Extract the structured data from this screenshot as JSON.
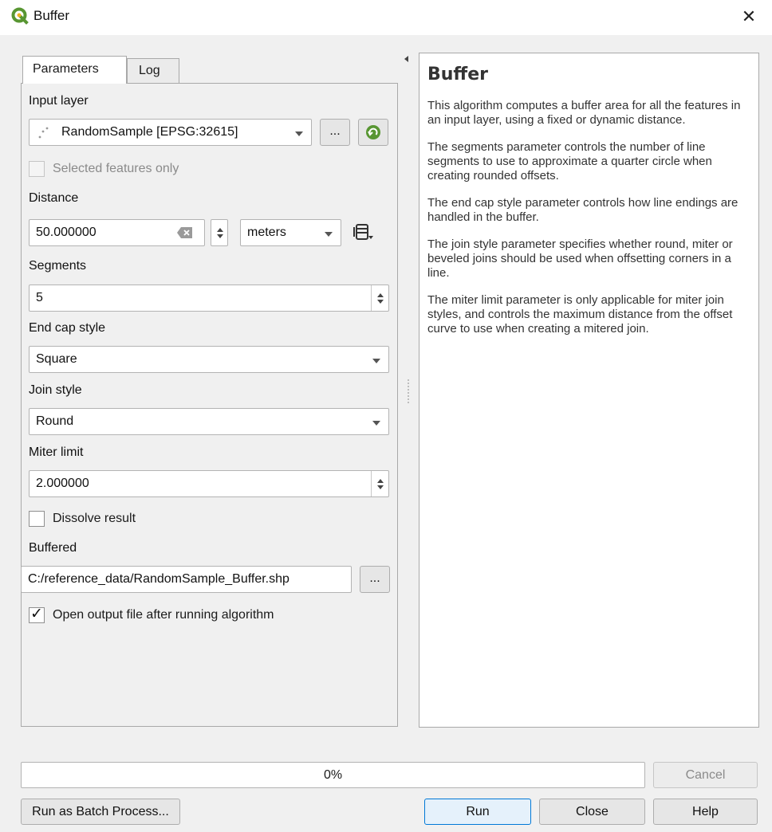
{
  "window": {
    "title": "Buffer"
  },
  "tabs": [
    {
      "label": "Parameters"
    },
    {
      "label": "Log"
    }
  ],
  "params": {
    "input_layer_label": "Input layer",
    "input_layer_value": "RandomSample [EPSG:32615]",
    "ellipsis": "...",
    "selected_only_label": "Selected features only",
    "selected_only_checked": false,
    "distance_label": "Distance",
    "distance_value": "50.000000",
    "distance_unit": "meters",
    "segments_label": "Segments",
    "segments_value": "5",
    "end_cap_label": "End cap style",
    "end_cap_value": "Square",
    "join_label": "Join style",
    "join_value": "Round",
    "miter_label": "Miter limit",
    "miter_value": "2.000000",
    "dissolve_label": "Dissolve result",
    "dissolve_checked": false,
    "buffered_label": "Buffered",
    "buffered_value": "C:/reference_data/RandomSample_Buffer.shp",
    "open_output_label": "Open output file after running algorithm",
    "open_output_checked": true
  },
  "help": {
    "title": "Buffer",
    "paragraphs": [
      "This algorithm computes a buffer area for all the features in an input layer, using a fixed or dynamic distance.",
      "The segments parameter controls the number of line segments to use to approximate a quarter circle when creating rounded offsets.",
      "The end cap style parameter controls how line endings are handled in the buffer.",
      "The join style parameter specifies whether round, miter or beveled joins should be used when offsetting corners in a line.",
      "The miter limit parameter is only applicable for miter join styles, and controls the maximum distance from the offset curve to use when creating a mitered join."
    ]
  },
  "progress": {
    "value": 0,
    "label": "0%"
  },
  "buttons": {
    "cancel": "Cancel",
    "batch": "Run as Batch Process...",
    "run": "Run",
    "close": "Close",
    "help": "Help"
  },
  "icons": {
    "app": "qgis-logo-icon",
    "close": "close-icon",
    "refresh": "iterate-refresh-icon",
    "data_defined": "data-defined-override-icon",
    "clear": "clear-field-icon"
  },
  "colors": {
    "accent": "#0078d7",
    "qgis_green": "#589632",
    "progress": "#06b025"
  }
}
